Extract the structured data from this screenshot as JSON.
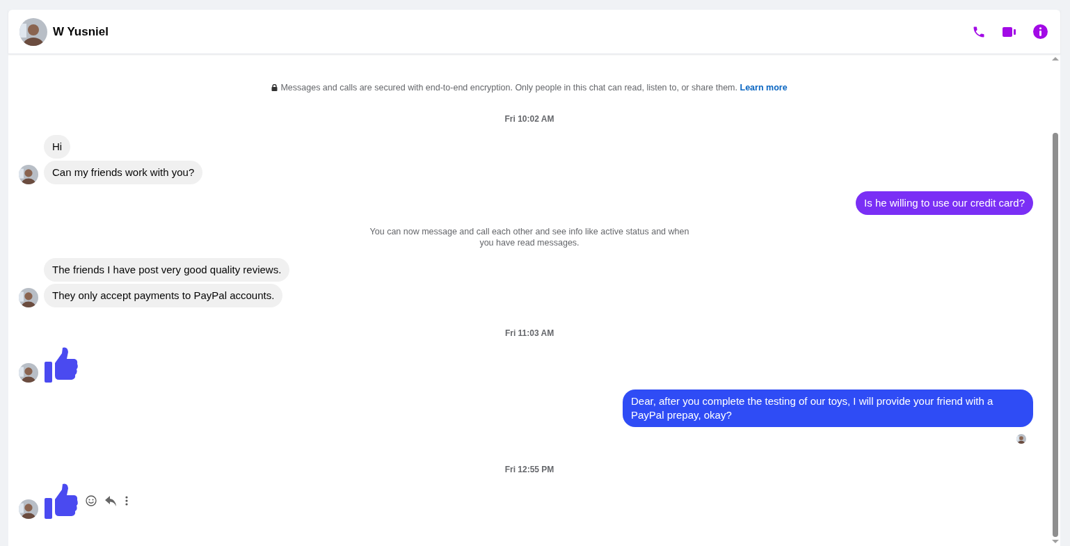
{
  "header": {
    "name": "W Yusniel"
  },
  "messages": [
    {
      "kind": "notice",
      "text": "Messages and calls are secured with end-to-end encryption. Only people in this chat can read, listen to, or share them.",
      "link": "Learn more",
      "lock": true
    },
    {
      "kind": "time",
      "text": "Fri 10:02 AM"
    },
    {
      "kind": "incoming",
      "bubbles": [
        "Hi",
        "Can my friends work with you?"
      ]
    },
    {
      "kind": "outgoing",
      "text": "Is he willing to use our credit card?",
      "color": "#7a2ff5",
      "seen": false
    },
    {
      "kind": "notice",
      "text": "You can now message and call each other and see info like active status and when you have read messages.",
      "lock": false
    },
    {
      "kind": "incoming",
      "bubbles": [
        "The friends I have post very good quality reviews.",
        "They only accept payments to PayPal accounts."
      ]
    },
    {
      "kind": "time",
      "text": "Fri 11:03 AM"
    },
    {
      "kind": "like",
      "actions": false
    },
    {
      "kind": "outgoing",
      "text": "Dear, after you complete the testing of our toys, I will provide your friend with a PayPal prepay, okay?",
      "color": "#2f4cf5",
      "seen": true
    },
    {
      "kind": "time",
      "text": "Fri 12:55 PM"
    },
    {
      "kind": "like",
      "actions": true
    }
  ]
}
